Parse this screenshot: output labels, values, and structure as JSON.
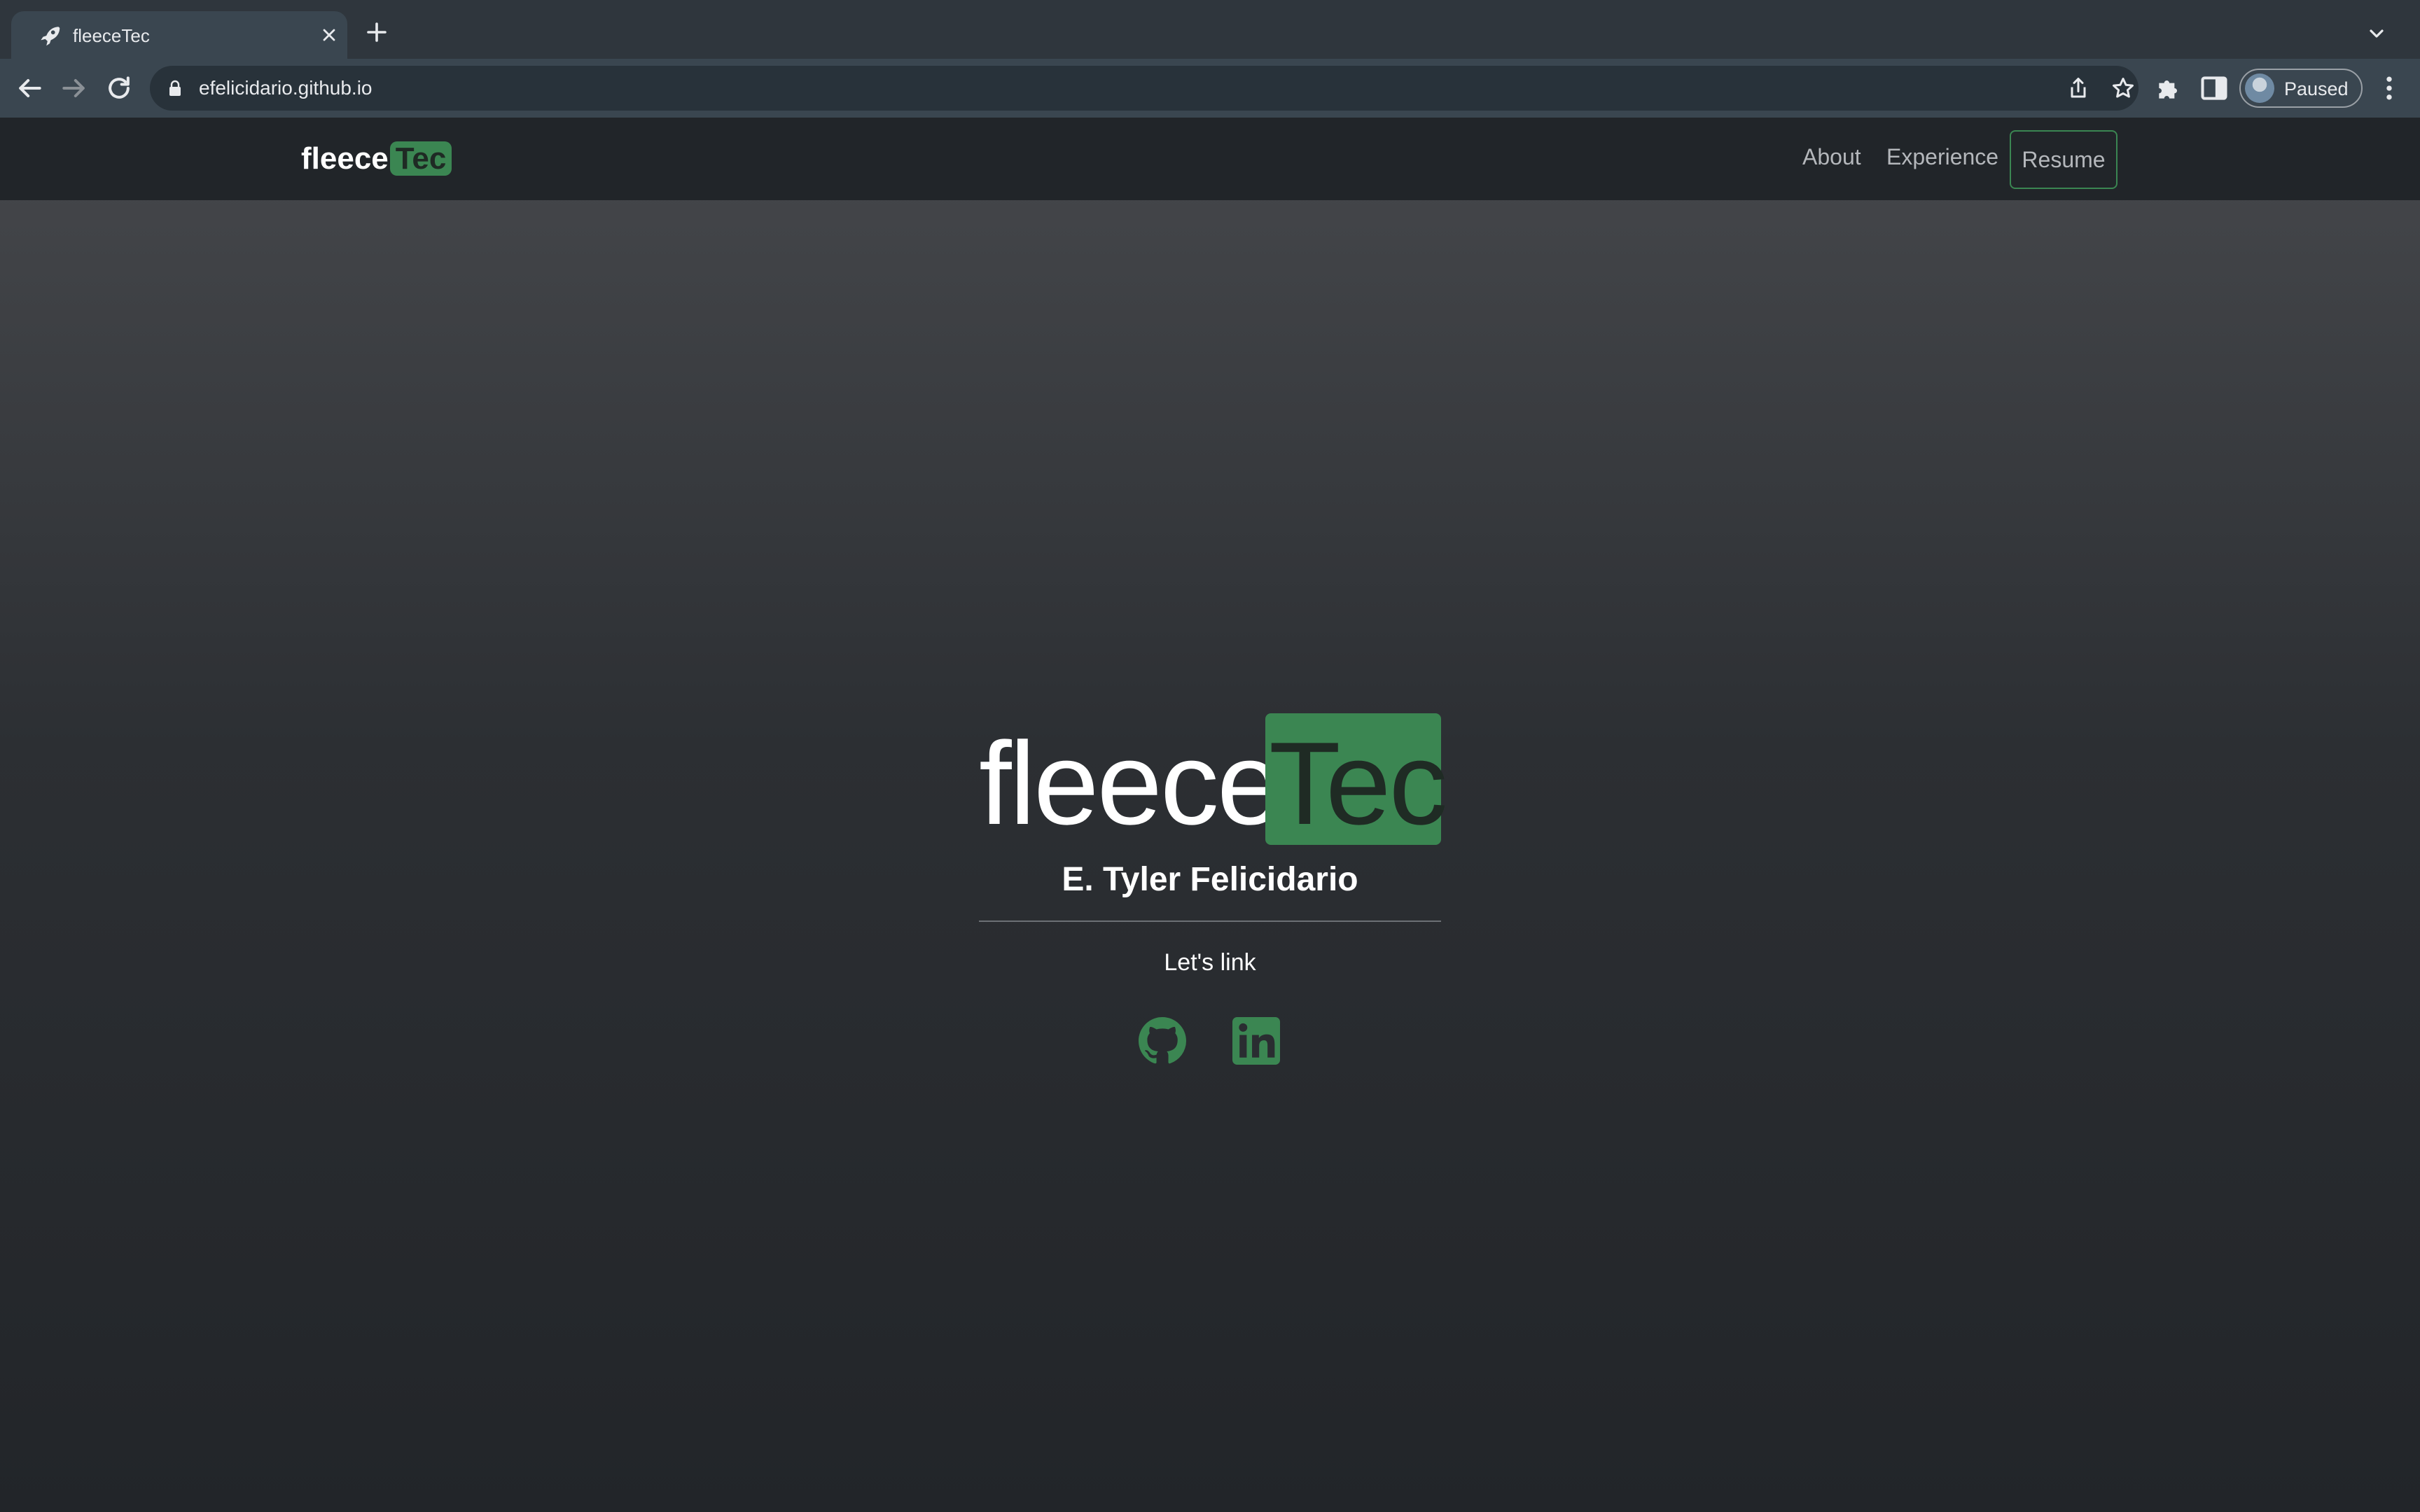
{
  "browser": {
    "tab_title": "fleeceTec",
    "url": "efelicidario.github.io",
    "profile_label": "Paused",
    "icons": [
      "rocket-favicon-icon",
      "close-icon",
      "plus-icon",
      "chevron-down-icon",
      "back-arrow-icon",
      "forward-arrow-icon",
      "reload-icon",
      "lock-icon",
      "share-icon",
      "star-icon",
      "puzzle-icon",
      "side-panel-icon",
      "kebab-menu-icon"
    ]
  },
  "site": {
    "brand_main": "fleece",
    "brand_accent": "Tec",
    "nav": {
      "about": "About",
      "experience": "Experience",
      "resume": "Resume"
    },
    "hero": {
      "logo_main": "fleece",
      "logo_accent": "Tec",
      "name": "E. Tyler Felicidario",
      "tagline": "Let's link"
    },
    "social_icons": [
      "github-icon",
      "linkedin-icon"
    ]
  },
  "colors": {
    "accent_green": "#3b8652",
    "navbar_bg": "#212529",
    "browser_toolbar": "#3a4650"
  }
}
